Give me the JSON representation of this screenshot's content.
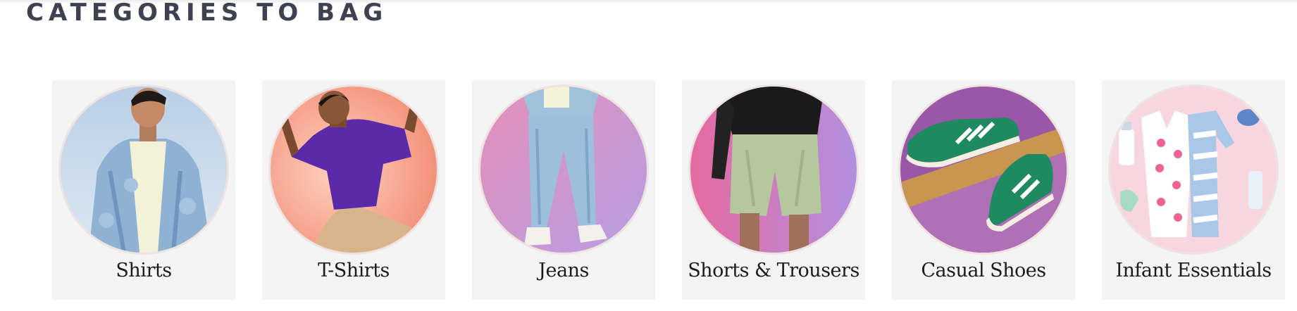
{
  "section": {
    "title": "CATEGORIES TO BAG"
  },
  "categories": [
    {
      "label": "Shirts",
      "image": "man-in-denim-shirt"
    },
    {
      "label": "T-Shirts",
      "image": "man-in-purple-polo"
    },
    {
      "label": "Jeans",
      "image": "light-blue-jeans"
    },
    {
      "label": "Shorts & Trousers",
      "image": "green-shorts"
    },
    {
      "label": "Casual Shoes",
      "image": "green-sneakers"
    },
    {
      "label": "Infant Essentials",
      "image": "baby-clothes-flatlay"
    }
  ]
}
